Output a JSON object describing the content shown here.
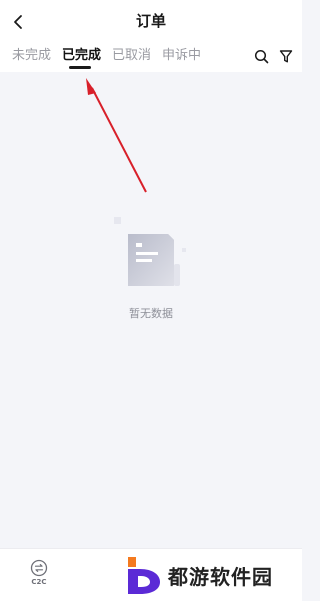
{
  "header": {
    "title": "订单",
    "back_icon": "chevron-left-icon"
  },
  "tabs": [
    {
      "label": "未完成",
      "active": false
    },
    {
      "label": "已完成",
      "active": true
    },
    {
      "label": "已取消",
      "active": false
    },
    {
      "label": "申诉中",
      "active": false
    }
  ],
  "toolbar": {
    "search_icon": "search-icon",
    "filter_icon": "filter-icon"
  },
  "empty_state": {
    "text": "暂无数据",
    "icon": "empty-document-icon"
  },
  "bottom_nav": {
    "c2c_label": "C2C",
    "c2c_icon": "exchange-icon"
  },
  "watermark": {
    "text": "都游软件园"
  },
  "colors": {
    "background": "#f4f5f9",
    "active_tab": "#121212",
    "inactive_tab": "#9a9ba2",
    "annotation_arrow": "#d8202a",
    "watermark_logo_purple": "#5b2ad6",
    "watermark_logo_orange": "#f47a1f"
  }
}
